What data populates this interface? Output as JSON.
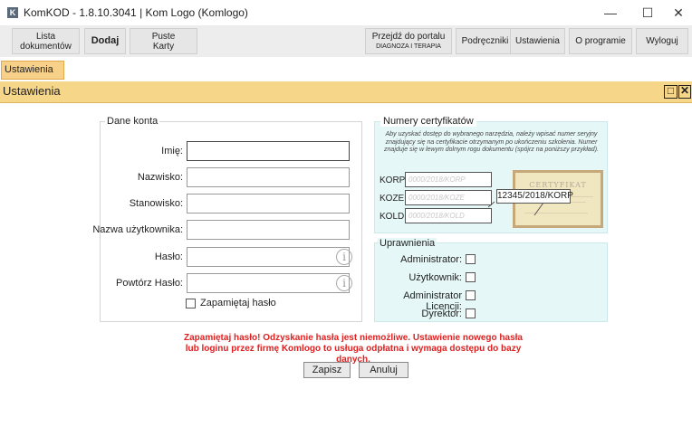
{
  "window": {
    "title": "KomKOD - 1.8.10.3041 | Kom Logo (Komlogo)",
    "app_icon_letter": "K",
    "minimize": "—",
    "maximize": "☐",
    "close": "✕"
  },
  "toolbar": {
    "lista_line1": "Lista",
    "lista_line2": "dokumentów",
    "dodaj": "Dodaj",
    "puste_line1": "Puste",
    "puste_line2": "Karty",
    "portal_line1": "Przejdź do portalu",
    "portal_line2": "DIAGNOZA I TERAPIA",
    "podreczniki": "Podręczniki",
    "ustawienia": "Ustawienia",
    "o_programie": "O programie",
    "wyloguj": "Wyloguj"
  },
  "tabs": {
    "active": "Ustawienia"
  },
  "panel": {
    "title": "Ustawienia",
    "restore_icon": "□",
    "close_icon": "✕"
  },
  "account": {
    "legend": "Dane konta",
    "imie_label": "Imię:",
    "imie_value": "",
    "nazwisko_label": "Nazwisko:",
    "nazwisko_value": "",
    "stanowisko_label": "Stanowisko:",
    "stanowisko_value": "",
    "username_label": "Nazwa użytkownika:",
    "username_value": "",
    "haslo_label": "Hasło:",
    "haslo_value": "",
    "powtorz_label": "Powtórz Hasło:",
    "powtorz_value": "",
    "remember_label": "Zapamiętaj hasło",
    "remember_checked": false,
    "info_glyph": "i"
  },
  "certificates": {
    "legend": "Numery certyfikatów",
    "hint": "Aby uzyskać dostęp do wybranego narzędzia, należy wpisać numer seryjny znajdujący się na certyfikacie otrzymanym po ukończeniu szkolenia. Numer znajduje się w lewym dolnym rogu dokumentu (spójrz na poniższy przykład).",
    "korp_label": "KORP:",
    "korp_placeholder": "0000/2018/KORP",
    "koze_label": "KOZE:",
    "koze_placeholder": "0000/2018/KOZE",
    "kold_label": "KOLD:",
    "kold_placeholder": "0000/2018/KOLD",
    "example_title": "CERTYFIKAT",
    "example_number": "12345/2018/KORP"
  },
  "permissions": {
    "legend": "Uprawnienia",
    "administrator": "Administrator:",
    "uzytkownik": "Użytkownik:",
    "admin_licencji": "Administrator Licencji:",
    "dyrektor": "Dyrektor:"
  },
  "warning": "Zapamiętaj hasło! Odzyskanie hasła jest niemożliwe. Ustawienie nowego hasła lub loginu przez firmę Komlogo to usługa odpłatna i wymaga dostępu do bazy danych.",
  "actions": {
    "save": "Zapisz",
    "cancel": "Anuluj"
  },
  "colors": {
    "accent_yellow": "#f6d689",
    "tab_orange": "#f7d08a",
    "cert_bg": "#e6f7f8",
    "warning_red": "#e02020"
  }
}
